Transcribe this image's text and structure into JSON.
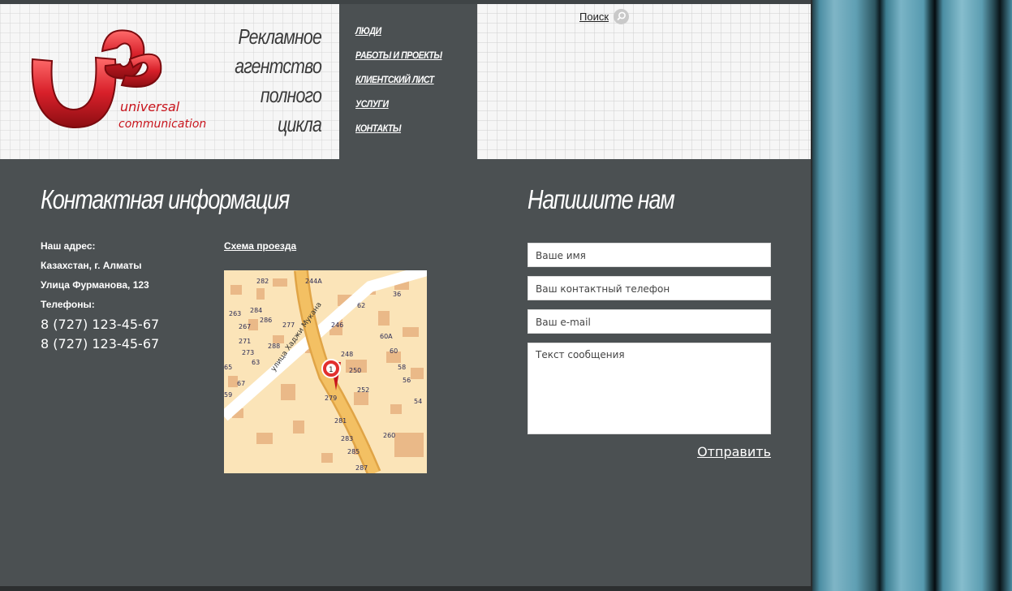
{
  "header": {
    "tagline": [
      "Рекламное",
      "агентство",
      "полного",
      "цикла"
    ],
    "logo_text_1": "universal",
    "logo_text_2": "communication",
    "search_label": "Поиск"
  },
  "nav": {
    "items": [
      "ЛЮДИ",
      "РАБОТЫ И ПРОЕКТЫ",
      "КЛИЕНТСКИЙ ЛИСТ",
      "УСЛУГИ",
      "КОНТАКТЫ"
    ]
  },
  "contact": {
    "heading": "Контактная информация",
    "address_label": "Наш адрес:",
    "address_line1": "Казахстан, г. Алматы",
    "address_line2": "Улица Фурманова, 123",
    "phones_label": "Телефоны:",
    "phones": [
      "8 (727) 123-45-67",
      "8 (727) 123-45-67"
    ],
    "map_link": "Схема проезда",
    "map": {
      "street": "улица Хаджи Мукана",
      "marker": "1",
      "numbers": [
        "282",
        "244A",
        "36",
        "263",
        "284",
        "62",
        "267",
        "286",
        "277",
        "246",
        "60A",
        "271",
        "288",
        "273",
        "248",
        "60",
        "65",
        "63",
        "250",
        "58",
        "67",
        "252",
        "56",
        "59",
        "279",
        "54",
        "281",
        "260",
        "283",
        "285",
        "287"
      ]
    }
  },
  "form": {
    "heading": "Напишите нам",
    "name_placeholder": "Ваше имя",
    "phone_placeholder": "Ваш контактный телефон",
    "email_placeholder": "Ваш e-mail",
    "message_placeholder": "Текст сообщения",
    "submit_label": "Отправить"
  },
  "colors": {
    "page_bg": "#4b5052",
    "logo_red": "#d8202a",
    "map_bg": "#fbe4b8",
    "road": "#f0b755"
  }
}
